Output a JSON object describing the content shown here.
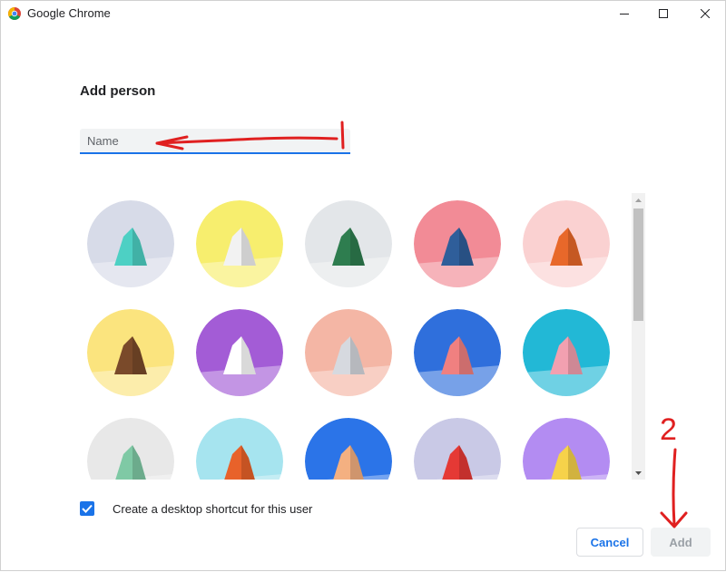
{
  "window": {
    "title": "Google Chrome",
    "icon": "chrome-icon"
  },
  "dialog": {
    "heading": "Add person",
    "name_placeholder": "Name",
    "name_value": "",
    "avatars": [
      {
        "name": "cat",
        "bg": "#d7dbe8",
        "accent": "#4dd0c4"
      },
      {
        "name": "corgi",
        "bg": "#f7ee6e",
        "accent": "#f2f2f2"
      },
      {
        "name": "dragon",
        "bg": "#e3e6e9",
        "accent": "#2e7d4f"
      },
      {
        "name": "elephant",
        "bg": "#f28b96",
        "accent": "#2f5e9a"
      },
      {
        "name": "fox",
        "bg": "#fad1d1",
        "accent": "#e8682a"
      },
      {
        "name": "monkey",
        "bg": "#fbe47e",
        "accent": "#7a4a2a"
      },
      {
        "name": "panda",
        "bg": "#a35cd6",
        "accent": "#ffffff"
      },
      {
        "name": "penguin",
        "bg": "#f4b6a5",
        "accent": "#d6d9df"
      },
      {
        "name": "butterfly",
        "bg": "#2f6fdc",
        "accent": "#f08080"
      },
      {
        "name": "rabbit",
        "bg": "#22b8d6",
        "accent": "#f2a0b0"
      },
      {
        "name": "unicorn",
        "bg": "#e8e8e8",
        "accent": "#7fc9a5"
      },
      {
        "name": "basketball",
        "bg": "#a6e4ef",
        "accent": "#e8622a"
      },
      {
        "name": "bicycle",
        "bg": "#2b74e8",
        "accent": "#f4b081"
      },
      {
        "name": "bird",
        "bg": "#c9c9e6",
        "accent": "#e53935"
      },
      {
        "name": "cheese",
        "bg": "#b38cf2",
        "accent": "#f6d24a"
      }
    ],
    "shortcut_checked": true,
    "shortcut_label": "Create a desktop shortcut for this user",
    "cancel_label": "Cancel",
    "add_label": "Add"
  },
  "annotations": {
    "step_two_label": "2",
    "color": "#e02020"
  },
  "colors": {
    "accent": "#1a73e8",
    "disabled_text": "#9aa0a6"
  }
}
